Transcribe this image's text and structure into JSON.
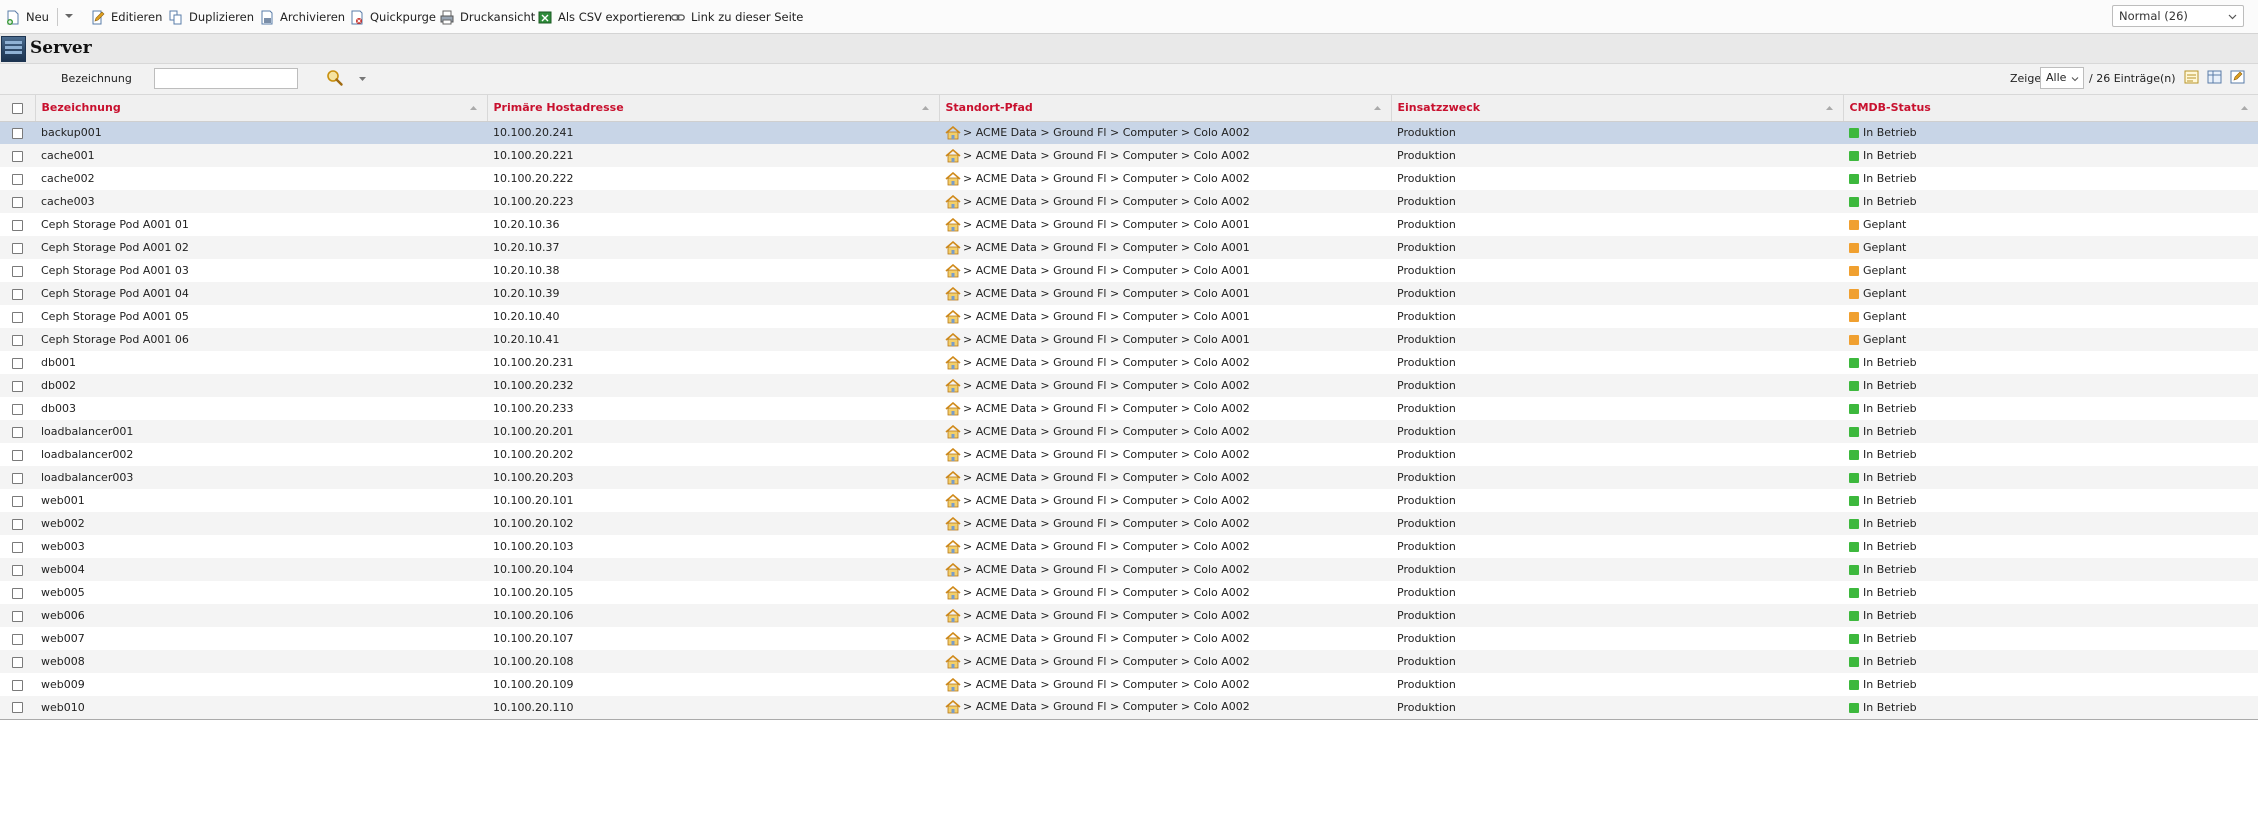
{
  "toolbar": {
    "new_label": "Neu",
    "edit_label": "Editieren",
    "duplicate_label": "Duplizieren",
    "archive_label": "Archivieren",
    "quickpurge_label": "Quickpurge",
    "print_label": "Druckansicht",
    "csv_label": "Als CSV exportieren",
    "link_label": "Link zu dieser Seite",
    "view_mode": "Normal (26)"
  },
  "header": {
    "title": "Server"
  },
  "filter": {
    "label": "Bezeichnung",
    "value": "",
    "show_label": "Zeige",
    "show_value": "Alle",
    "entries_label": "/ 26 Einträge(n)"
  },
  "table": {
    "columns": [
      "Bezeichnung",
      "Primäre Hostadresse",
      "Standort-Pfad",
      "Einsatzzweck",
      "CMDB-Status"
    ],
    "rows": [
      {
        "name": "backup001",
        "ip": "10.100.20.241",
        "location": "> ACME Data > Ground Fl > Computer > Colo A002",
        "purpose": "Produktion",
        "status": "In Betrieb",
        "status_color": "#3db83d"
      },
      {
        "name": "cache001",
        "ip": "10.100.20.221",
        "location": "> ACME Data > Ground Fl > Computer > Colo A002",
        "purpose": "Produktion",
        "status": "In Betrieb",
        "status_color": "#3db83d"
      },
      {
        "name": "cache002",
        "ip": "10.100.20.222",
        "location": "> ACME Data > Ground Fl > Computer > Colo A002",
        "purpose": "Produktion",
        "status": "In Betrieb",
        "status_color": "#3db83d"
      },
      {
        "name": "cache003",
        "ip": "10.100.20.223",
        "location": "> ACME Data > Ground Fl > Computer > Colo A002",
        "purpose": "Produktion",
        "status": "In Betrieb",
        "status_color": "#3db83d"
      },
      {
        "name": "Ceph Storage Pod A001 01",
        "ip": "10.20.10.36",
        "location": "> ACME Data > Ground Fl > Computer > Colo A001",
        "purpose": "Produktion",
        "status": "Geplant",
        "status_color": "#f0a030"
      },
      {
        "name": "Ceph Storage Pod A001 02",
        "ip": "10.20.10.37",
        "location": "> ACME Data > Ground Fl > Computer > Colo A001",
        "purpose": "Produktion",
        "status": "Geplant",
        "status_color": "#f0a030"
      },
      {
        "name": "Ceph Storage Pod A001 03",
        "ip": "10.20.10.38",
        "location": "> ACME Data > Ground Fl > Computer > Colo A001",
        "purpose": "Produktion",
        "status": "Geplant",
        "status_color": "#f0a030"
      },
      {
        "name": "Ceph Storage Pod A001 04",
        "ip": "10.20.10.39",
        "location": "> ACME Data > Ground Fl > Computer > Colo A001",
        "purpose": "Produktion",
        "status": "Geplant",
        "status_color": "#f0a030"
      },
      {
        "name": "Ceph Storage Pod A001 05",
        "ip": "10.20.10.40",
        "location": "> ACME Data > Ground Fl > Computer > Colo A001",
        "purpose": "Produktion",
        "status": "Geplant",
        "status_color": "#f0a030"
      },
      {
        "name": "Ceph Storage Pod A001 06",
        "ip": "10.20.10.41",
        "location": "> ACME Data > Ground Fl > Computer > Colo A001",
        "purpose": "Produktion",
        "status": "Geplant",
        "status_color": "#f0a030"
      },
      {
        "name": "db001",
        "ip": "10.100.20.231",
        "location": "> ACME Data > Ground Fl > Computer > Colo A002",
        "purpose": "Produktion",
        "status": "In Betrieb",
        "status_color": "#3db83d"
      },
      {
        "name": "db002",
        "ip": "10.100.20.232",
        "location": "> ACME Data > Ground Fl > Computer > Colo A002",
        "purpose": "Produktion",
        "status": "In Betrieb",
        "status_color": "#3db83d"
      },
      {
        "name": "db003",
        "ip": "10.100.20.233",
        "location": "> ACME Data > Ground Fl > Computer > Colo A002",
        "purpose": "Produktion",
        "status": "In Betrieb",
        "status_color": "#3db83d"
      },
      {
        "name": "loadbalancer001",
        "ip": "10.100.20.201",
        "location": "> ACME Data > Ground Fl > Computer > Colo A002",
        "purpose": "Produktion",
        "status": "In Betrieb",
        "status_color": "#3db83d"
      },
      {
        "name": "loadbalancer002",
        "ip": "10.100.20.202",
        "location": "> ACME Data > Ground Fl > Computer > Colo A002",
        "purpose": "Produktion",
        "status": "In Betrieb",
        "status_color": "#3db83d"
      },
      {
        "name": "loadbalancer003",
        "ip": "10.100.20.203",
        "location": "> ACME Data > Ground Fl > Computer > Colo A002",
        "purpose": "Produktion",
        "status": "In Betrieb",
        "status_color": "#3db83d"
      },
      {
        "name": "web001",
        "ip": "10.100.20.101",
        "location": "> ACME Data > Ground Fl > Computer > Colo A002",
        "purpose": "Produktion",
        "status": "In Betrieb",
        "status_color": "#3db83d"
      },
      {
        "name": "web002",
        "ip": "10.100.20.102",
        "location": "> ACME Data > Ground Fl > Computer > Colo A002",
        "purpose": "Produktion",
        "status": "In Betrieb",
        "status_color": "#3db83d"
      },
      {
        "name": "web003",
        "ip": "10.100.20.103",
        "location": "> ACME Data > Ground Fl > Computer > Colo A002",
        "purpose": "Produktion",
        "status": "In Betrieb",
        "status_color": "#3db83d"
      },
      {
        "name": "web004",
        "ip": "10.100.20.104",
        "location": "> ACME Data > Ground Fl > Computer > Colo A002",
        "purpose": "Produktion",
        "status": "In Betrieb",
        "status_color": "#3db83d"
      },
      {
        "name": "web005",
        "ip": "10.100.20.105",
        "location": "> ACME Data > Ground Fl > Computer > Colo A002",
        "purpose": "Produktion",
        "status": "In Betrieb",
        "status_color": "#3db83d"
      },
      {
        "name": "web006",
        "ip": "10.100.20.106",
        "location": "> ACME Data > Ground Fl > Computer > Colo A002",
        "purpose": "Produktion",
        "status": "In Betrieb",
        "status_color": "#3db83d"
      },
      {
        "name": "web007",
        "ip": "10.100.20.107",
        "location": "> ACME Data > Ground Fl > Computer > Colo A002",
        "purpose": "Produktion",
        "status": "In Betrieb",
        "status_color": "#3db83d"
      },
      {
        "name": "web008",
        "ip": "10.100.20.108",
        "location": "> ACME Data > Ground Fl > Computer > Colo A002",
        "purpose": "Produktion",
        "status": "In Betrieb",
        "status_color": "#3db83d"
      },
      {
        "name": "web009",
        "ip": "10.100.20.109",
        "location": "> ACME Data > Ground Fl > Computer > Colo A002",
        "purpose": "Produktion",
        "status": "In Betrieb",
        "status_color": "#3db83d"
      },
      {
        "name": "web010",
        "ip": "10.100.20.110",
        "location": "> ACME Data > Ground Fl > Computer > Colo A002",
        "purpose": "Produktion",
        "status": "In Betrieb",
        "status_color": "#3db83d"
      }
    ]
  },
  "icons": {
    "new": "new-document-icon",
    "edit": "edit-icon",
    "duplicate": "duplicate-icon",
    "archive": "archive-icon",
    "quickpurge": "quickpurge-icon",
    "print": "print-icon",
    "csv": "csv-export-icon",
    "link": "link-icon",
    "object_type": "server-icon",
    "search": "search-icon",
    "location": "building-icon"
  },
  "colors": {
    "header_text": "#c8102e",
    "selected_row": "#c8d5e7",
    "status_in_operation": "#3db83d",
    "status_planned": "#f0a030"
  }
}
